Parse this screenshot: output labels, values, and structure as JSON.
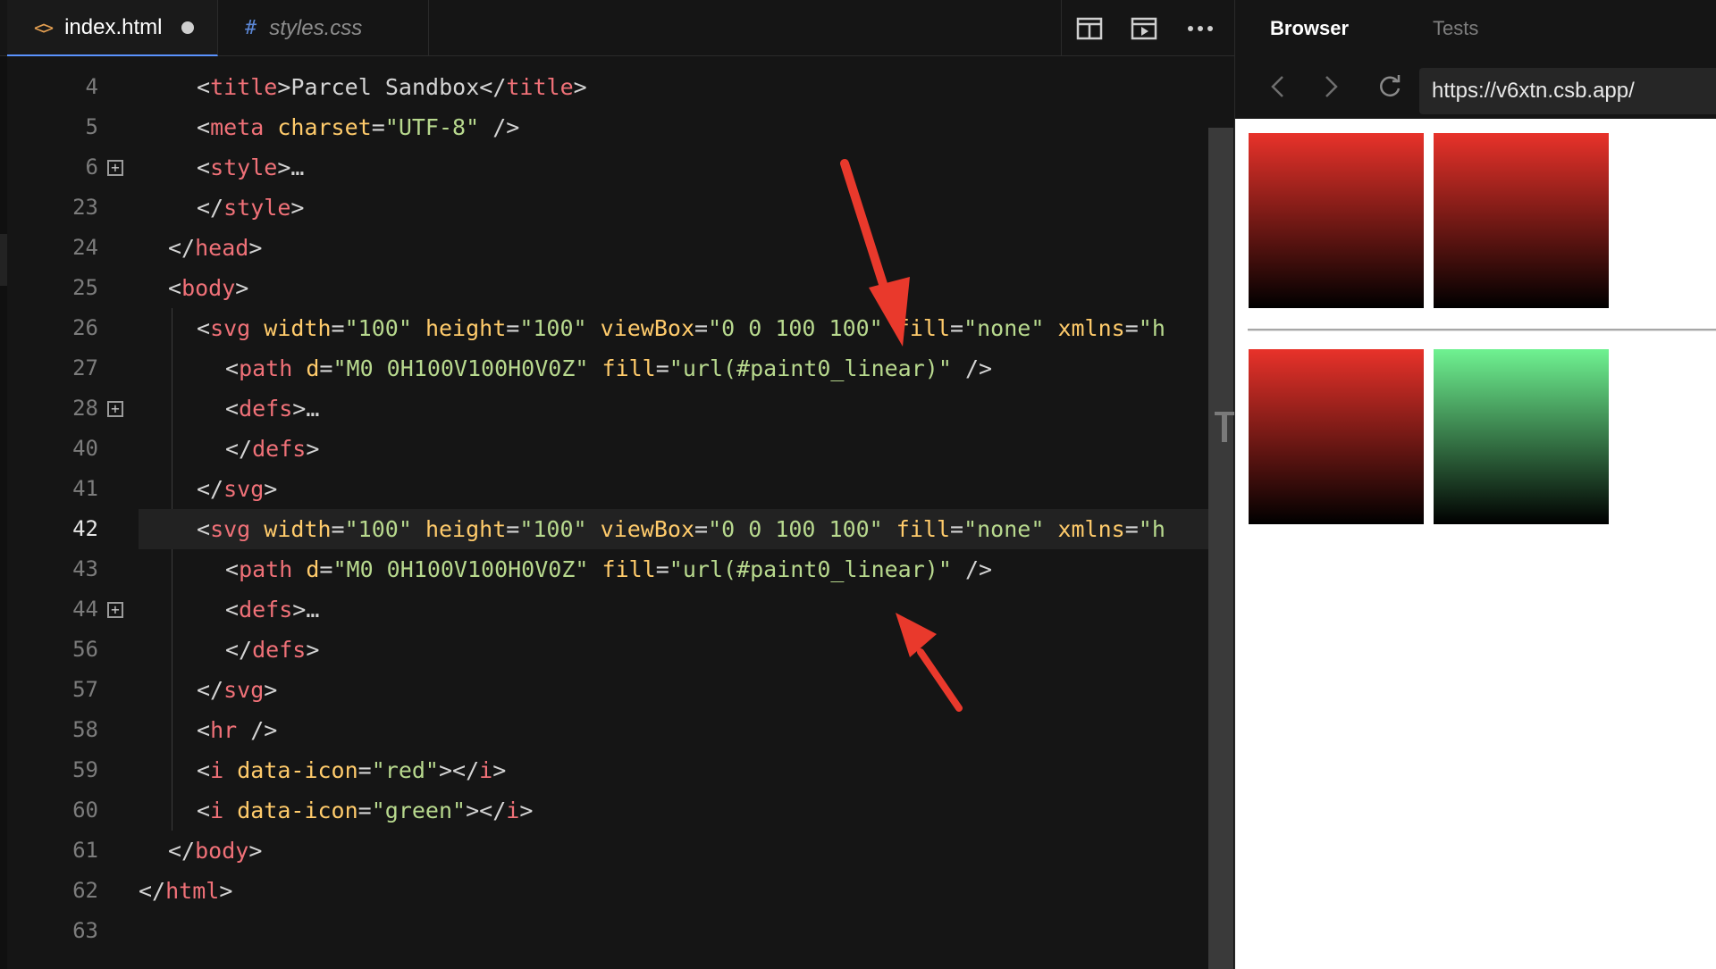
{
  "editor": {
    "tabs": [
      {
        "label": "index.html",
        "icon": "code-icon",
        "active": true,
        "dirty": true
      },
      {
        "label": "styles.css",
        "icon": "hash-icon",
        "active": false,
        "dirty": false
      }
    ],
    "active_line": "42",
    "line_numbers": [
      "4",
      "5",
      "6",
      "23",
      "24",
      "25",
      "26",
      "27",
      "28",
      "40",
      "41",
      "42",
      "43",
      "44",
      "56",
      "57",
      "58",
      "59",
      "60",
      "61",
      "62",
      "63"
    ],
    "code_lines": [
      "<title>Parcel Sandbox</title>",
      "<meta charset=\"UTF-8\" />",
      "<style>…",
      "</style>",
      "</head>",
      "<body>",
      "<svg width=\"100\" height=\"100\" viewBox=\"0 0 100 100\" fill=\"none\" xmlns=\"h",
      "<path d=\"M0 0H100V100H0V0Z\" fill=\"url(#paint0_linear)\" />",
      "<defs>…",
      "</defs>",
      "</svg>",
      "<svg width=\"100\" height=\"100\" viewBox=\"0 0 100 100\" fill=\"none\" xmlns=\"h",
      "<path d=\"M0 0H100V100H0V0Z\" fill=\"url(#paint0_linear)\" />",
      "<defs>…",
      "</defs>",
      "</svg>",
      "<hr />",
      "<i data-icon=\"red\"></i>",
      "<i data-icon=\"green\"></i>",
      "</body>",
      "</html>",
      ""
    ]
  },
  "browser": {
    "tabs": [
      "Browser",
      "Tests"
    ],
    "url": "https://v6xtn.csb.app/",
    "swatches": [
      {
        "top": "#e8322a",
        "bottom": "#000000"
      },
      {
        "top": "#e8322a",
        "bottom": "#000000"
      },
      {
        "top": "#e8322a",
        "bottom": "#000000"
      },
      {
        "top": "#6ff291",
        "bottom": "#000000"
      }
    ]
  },
  "colors": {
    "accent": "#5a93ff",
    "annotation_arrow": "#e9392c"
  }
}
